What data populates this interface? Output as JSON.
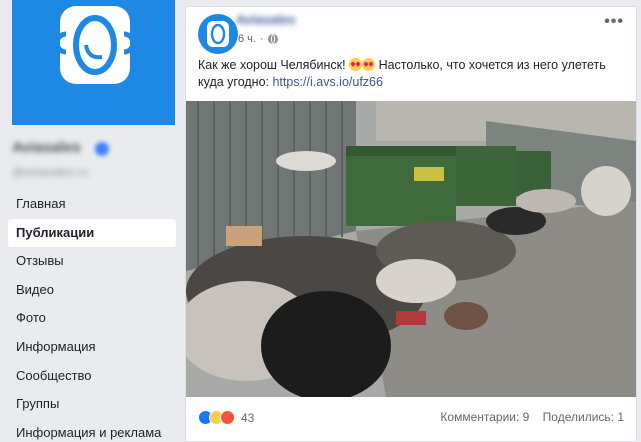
{
  "sidebar": {
    "page_name": "Aviasales",
    "page_handle": "@aviasales.ru",
    "nav": [
      {
        "label": "Главная",
        "active": false
      },
      {
        "label": "Публикации",
        "active": true
      },
      {
        "label": "Отзывы",
        "active": false
      },
      {
        "label": "Видео",
        "active": false
      },
      {
        "label": "Фото",
        "active": false
      },
      {
        "label": "Информация",
        "active": false
      },
      {
        "label": "Сообщество",
        "active": false
      },
      {
        "label": "Группы",
        "active": false
      },
      {
        "label": "Информация и реклама",
        "active": false
      }
    ]
  },
  "post": {
    "author": "Aviasales",
    "time": "6 ч.",
    "more": "•••",
    "text_before": "Как же хорош Челябинск!",
    "text_middle": "Настолько, что хочется из него улететь куда угодно:",
    "link": "https://i.avs.io/ufz66",
    "reaction_count": "43",
    "comments": "Комментарии: 9",
    "shares": "Поделились: 1"
  },
  "colors": {
    "brand_blue": "#1e88e5",
    "link": "#385898"
  }
}
